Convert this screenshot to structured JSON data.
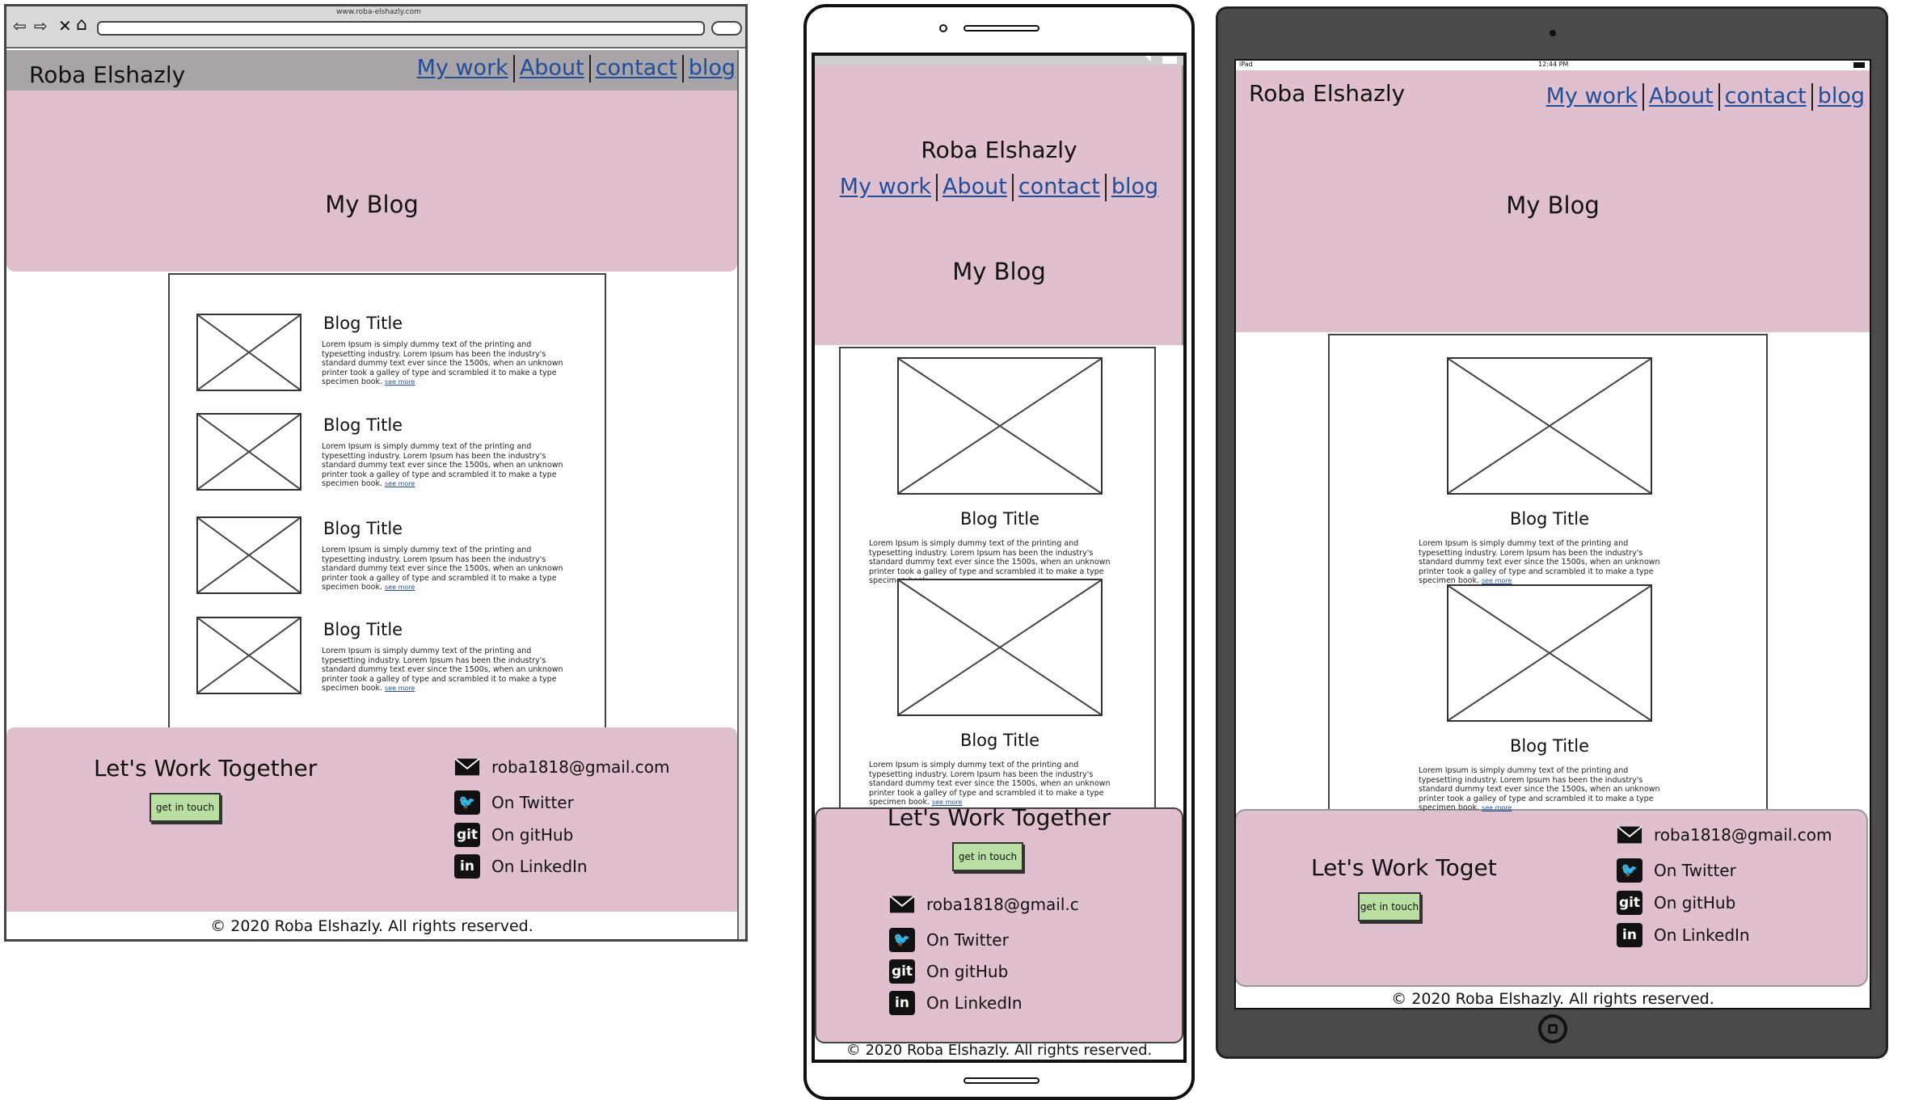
{
  "browser": {
    "url": "www.roba-elshazly.com"
  },
  "site": {
    "name": "Roba Elshazly",
    "nav": [
      "My work",
      "About",
      "contact",
      "blog"
    ],
    "hero_title": "My Blog",
    "post": {
      "title": "Blog Title",
      "text": "Lorem Ipsum is simply dummy text of the printing and typesetting industry. Lorem Ipsum has been the industry's standard dummy text ever since the 1500s, when an unknown printer took a galley of type and scrambled it to make a type specimen book.",
      "more": "see more"
    },
    "contact": {
      "heading": "Let's Work Together",
      "heading_tablet": "Let's Work Toget",
      "button": "get in touch",
      "email": "roba1818@gmail.com",
      "email_mobile": "roba1818@gmail.c",
      "twitter": "On Twitter",
      "github": "On gitHub",
      "linkedin": "On LinkedIn"
    },
    "footer": "© 2020 Roba Elshazly. All rights reserved."
  },
  "status": {
    "tablet_device": "iPad",
    "tablet_time": "12:44 PM"
  },
  "icons": [
    "back-arrow-icon",
    "forward-arrow-icon",
    "close-icon",
    "home-icon",
    "search-icon",
    "mail-icon",
    "twitter-icon",
    "github-icon",
    "linkedin-icon",
    "wifi-icon",
    "battery-icon",
    "home-button-icon"
  ],
  "colors": {
    "pink": "#e0bfcf",
    "button": "#b9dfa2",
    "link": "#1f4f9a",
    "tablet_frame": "#4a4a4a"
  }
}
